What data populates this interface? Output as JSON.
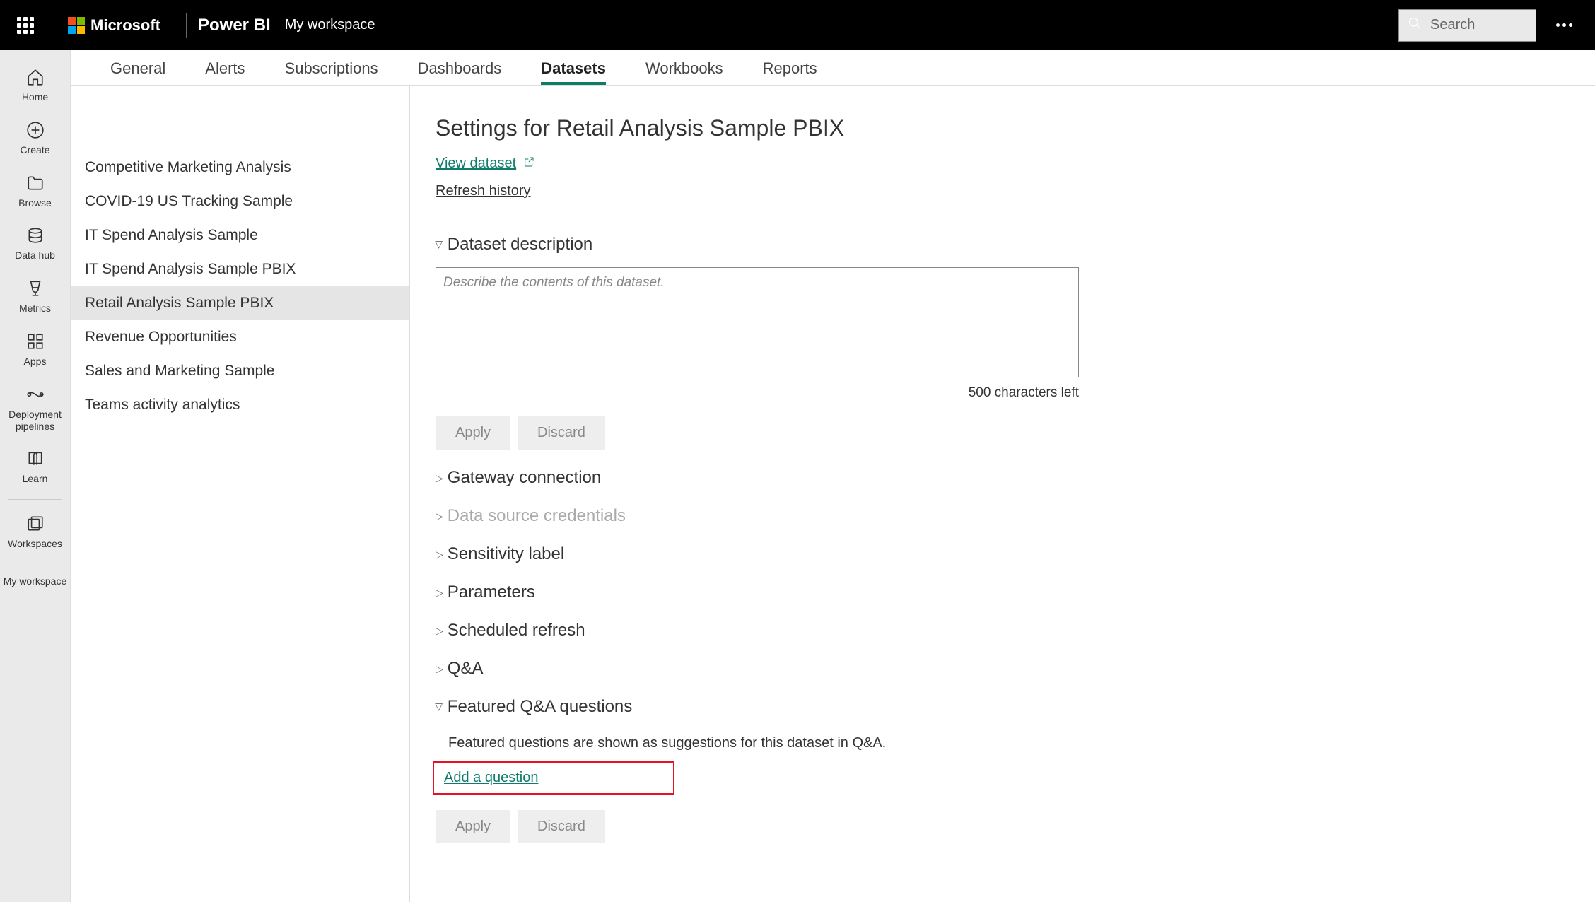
{
  "header": {
    "microsoft": "Microsoft",
    "product": "Power BI",
    "breadcrumb": "My workspace",
    "search_placeholder": "Search"
  },
  "leftNav": {
    "home": "Home",
    "create": "Create",
    "browse": "Browse",
    "dataHub": "Data hub",
    "metrics": "Metrics",
    "apps": "Apps",
    "deploymentPipelines": "Deployment pipelines",
    "learn": "Learn",
    "workspaces": "Workspaces",
    "myWorkspace": "My workspace"
  },
  "tabs": {
    "general": "General",
    "alerts": "Alerts",
    "subscriptions": "Subscriptions",
    "dashboards": "Dashboards",
    "datasets": "Datasets",
    "workbooks": "Workbooks",
    "reports": "Reports"
  },
  "datasetList": [
    "Competitive Marketing Analysis",
    "COVID-19 US Tracking Sample",
    "IT Spend Analysis Sample",
    "IT Spend Analysis Sample PBIX",
    "Retail Analysis Sample PBIX",
    "Revenue Opportunities",
    "Sales and Marketing Sample",
    "Teams activity analytics"
  ],
  "settings": {
    "title": "Settings for Retail Analysis Sample PBIX",
    "viewDataset": "View dataset",
    "refreshHistory": "Refresh history",
    "sections": {
      "datasetDescription": "Dataset description",
      "gatewayConnection": "Gateway connection",
      "dataSourceCredentials": "Data source credentials",
      "sensitivityLabel": "Sensitivity label",
      "parameters": "Parameters",
      "scheduledRefresh": "Scheduled refresh",
      "qa": "Q&A",
      "featuredQA": "Featured Q&A questions"
    },
    "descriptionPlaceholder": "Describe the contents of this dataset.",
    "charCount": "500 characters left",
    "applyBtn": "Apply",
    "discardBtn": "Discard",
    "featuredDescription": "Featured questions are shown as suggestions for this dataset in Q&A.",
    "addQuestion": "Add a question"
  }
}
